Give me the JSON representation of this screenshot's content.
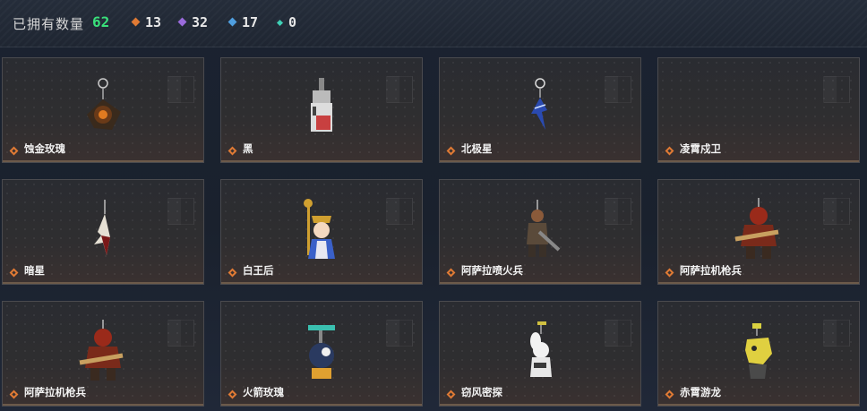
{
  "header": {
    "owned_label": "已拥有数量",
    "owned_count": "62",
    "stats": [
      {
        "icon": "orange-diamond-icon",
        "value": "13",
        "color": "#e07a34"
      },
      {
        "icon": "purple-diamond-icon",
        "value": "32",
        "color": "#9a6bdc"
      },
      {
        "icon": "blue-diamond-icon",
        "value": "17",
        "color": "#4f9fe0"
      },
      {
        "icon": "teal-diamond-icon",
        "value": "0",
        "color": "#3fd0b6"
      }
    ]
  },
  "items": [
    {
      "name": "蚀金玫瑰",
      "rarity_icon": "orange-diamond-icon",
      "thumb": "rose-charm"
    },
    {
      "name": "黑",
      "rarity_icon": "orange-diamond-icon",
      "thumb": "black-tag-charm"
    },
    {
      "name": "北极星",
      "rarity_icon": "orange-diamond-icon",
      "thumb": "polaris-charm"
    },
    {
      "name": "凌霄戍卫",
      "rarity_icon": "orange-diamond-icon",
      "thumb": "empty"
    },
    {
      "name": "暗星",
      "rarity_icon": "orange-diamond-icon",
      "thumb": "dark-star-charm"
    },
    {
      "name": "白王后",
      "rarity_icon": "orange-diamond-icon",
      "thumb": "white-queen-charm"
    },
    {
      "name": "阿萨拉喷火兵",
      "rarity_icon": "orange-diamond-icon",
      "thumb": "flamethrower-soldier-charm"
    },
    {
      "name": "阿萨拉机枪兵",
      "rarity_icon": "orange-diamond-icon",
      "thumb": "machine-gunner-charm"
    },
    {
      "name": "阿萨拉机枪兵",
      "rarity_icon": "orange-diamond-icon",
      "thumb": "machine-gunner-charm"
    },
    {
      "name": "火箭玫瑰",
      "rarity_icon": "orange-diamond-icon",
      "thumb": "rocket-rose-charm"
    },
    {
      "name": "窃风密探",
      "rarity_icon": "orange-diamond-icon",
      "thumb": "wind-spy-charm"
    },
    {
      "name": "赤霄游龙",
      "rarity_icon": "orange-diamond-icon",
      "thumb": "dragon-charm"
    }
  ]
}
